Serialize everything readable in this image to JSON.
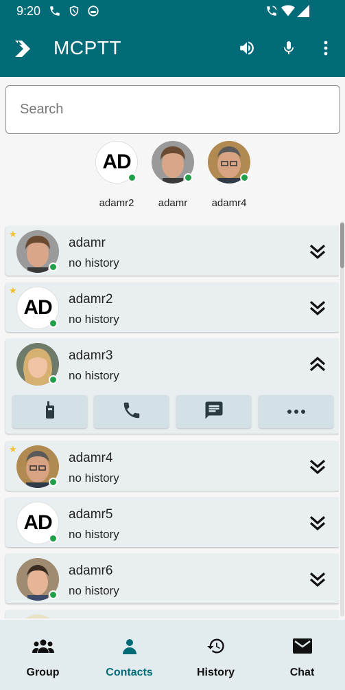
{
  "status_bar": {
    "time": "9:20"
  },
  "app_bar": {
    "title": "MCPTT"
  },
  "search": {
    "placeholder": "Search"
  },
  "favorites": [
    {
      "label": "adamr2",
      "initials": "AD"
    },
    {
      "label": "adamr"
    },
    {
      "label": "adamr4"
    }
  ],
  "contacts": [
    {
      "name": "adamr",
      "status": "no history",
      "starred": true
    },
    {
      "name": "adamr2",
      "status": "no history",
      "starred": true,
      "initials": "AD"
    },
    {
      "name": "adamr3",
      "status": "no history",
      "starred": false,
      "expanded": true
    },
    {
      "name": "adamr4",
      "status": "no history",
      "starred": true
    },
    {
      "name": "adamr5",
      "status": "no history",
      "starred": false,
      "initials": "AD"
    },
    {
      "name": "adamr6",
      "status": "no history",
      "starred": false
    }
  ],
  "contact_actions": [
    "radio-icon",
    "phone-icon",
    "message-icon",
    "more-icon"
  ],
  "bottom_nav": {
    "group": "Group",
    "contacts": "Contacts",
    "history": "History",
    "chat": "Chat",
    "active": "Contacts"
  },
  "colors": {
    "primary": "#036a78",
    "online": "#21a04a",
    "star": "#f0c030"
  }
}
